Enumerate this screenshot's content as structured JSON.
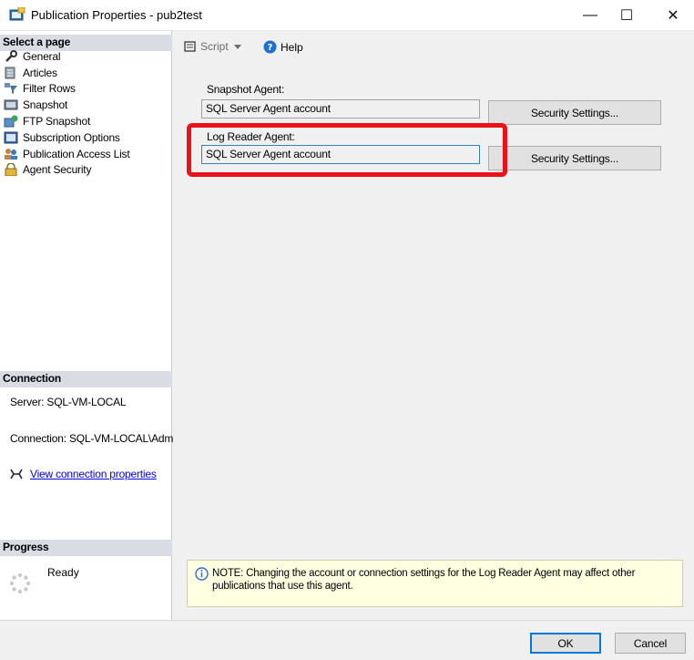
{
  "window": {
    "title": "Publication Properties - pub2test",
    "minimize_glyph": "—",
    "maximize_glyph": "☐",
    "close_glyph": "✕"
  },
  "left_pane": {
    "select_page_header": "Select a page",
    "pages": [
      {
        "label": "General",
        "icon": "wrench-icon"
      },
      {
        "label": "Articles",
        "icon": "articles-icon"
      },
      {
        "label": "Filter Rows",
        "icon": "filter-icon"
      },
      {
        "label": "Snapshot",
        "icon": "snapshot-icon"
      },
      {
        "label": "FTP Snapshot",
        "icon": "ftp-snapshot-icon"
      },
      {
        "label": "Subscription Options",
        "icon": "subscription-icon"
      },
      {
        "label": "Publication Access List",
        "icon": "users-icon"
      },
      {
        "label": "Agent Security",
        "icon": "lock-icon"
      }
    ],
    "connection_header": "Connection",
    "server_line": "Server: SQL-VM-LOCAL",
    "connection_line": "Connection: SQL-VM-LOCAL\\Adm",
    "view_connection_link": "View connection properties",
    "progress_header": "Progress",
    "progress_status": "Ready"
  },
  "toolbar": {
    "script_label": "Script",
    "help_label": "Help"
  },
  "main": {
    "snapshot_agent_label": "Snapshot Agent:",
    "snapshot_agent_value": "SQL Server Agent account",
    "snapshot_security_button": "Security Settings...",
    "log_reader_label": "Log Reader Agent:",
    "log_reader_value": "SQL Server Agent account",
    "log_reader_security_button": "Security Settings...",
    "note_line1": "NOTE: Changing the account or connection settings for the Log Reader Agent may affect other",
    "note_line2": "publications that use this agent."
  },
  "footer": {
    "ok_label": "OK",
    "cancel_label": "Cancel"
  },
  "colors": {
    "highlight": "#e8121b",
    "section_header": "#d9dde3",
    "note_background": "#ffffe1",
    "link": "#0000ee"
  }
}
